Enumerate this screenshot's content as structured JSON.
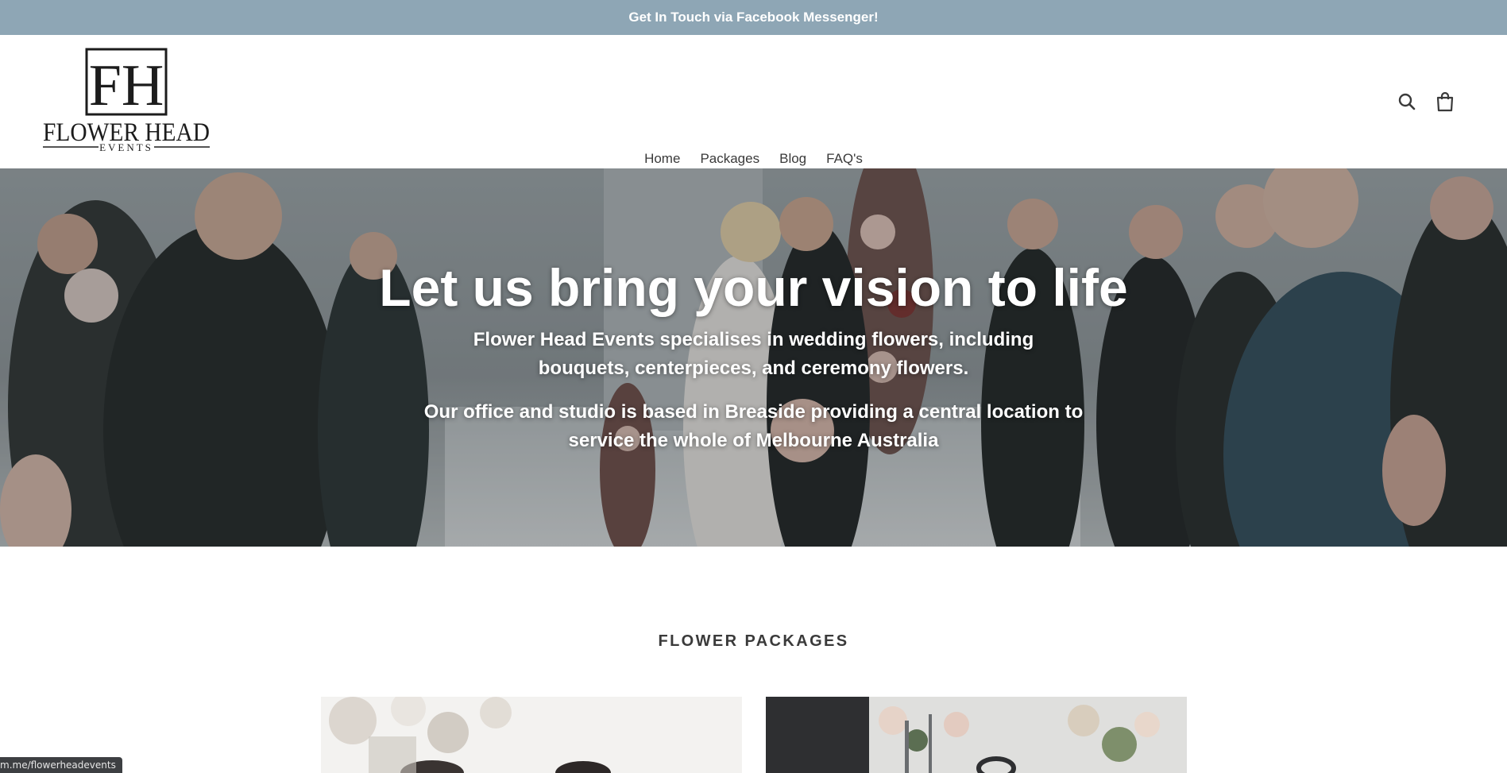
{
  "announcement": {
    "text": "Get In Touch via Facebook Messenger!"
  },
  "brand": {
    "monogram": "FH",
    "name": "FLOWER HEAD",
    "tagline": "EVENTS"
  },
  "nav": {
    "items": [
      {
        "label": "Home",
        "active": true
      },
      {
        "label": "Packages",
        "active": false
      },
      {
        "label": "Blog",
        "active": false
      },
      {
        "label": "FAQ's",
        "active": false
      }
    ]
  },
  "header_icons": {
    "search": "search-icon",
    "cart": "cart-icon"
  },
  "hero": {
    "title": "Let us bring your vision to life",
    "paragraph1": "Flower Head Events specialises in wedding flowers, including bouquets, centerpieces, and ceremony flowers.",
    "paragraph2": "Our office and studio is based in Breaside providing a central location to service the whole of Melbourne Australia"
  },
  "packages": {
    "title": "FLOWER PACKAGES"
  },
  "status_bar": {
    "url": "m.me/flowerheadevents"
  },
  "colors": {
    "announcement_bg": "#8ea6b5",
    "text": "#3a3a3a",
    "white": "#ffffff"
  }
}
